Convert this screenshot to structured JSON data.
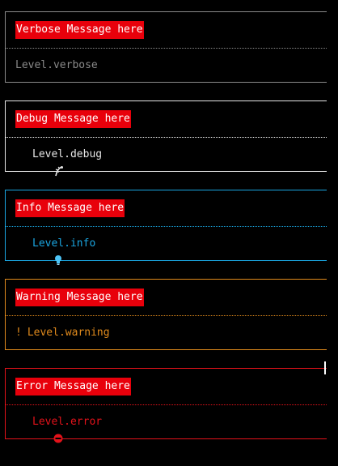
{
  "colors": {
    "verbose": "#8a8a8a",
    "debug": "#e6e6e6",
    "info": "#1aa5e0",
    "warning": "#e08a1c",
    "error": "#e3121a",
    "title_bg": "#e8000b"
  },
  "logs": [
    {
      "message": "Verbose Message here",
      "level": "Level.verbose",
      "icon": "none"
    },
    {
      "message": "Debug Message here",
      "level": "Level.debug",
      "icon": "bug-icon"
    },
    {
      "message": "Info Message here",
      "level": "Level.info",
      "icon": "lightbulb-icon"
    },
    {
      "message": "Warning Message here",
      "level": "Level.warning",
      "icon": "exclamation-icon",
      "icon_glyph": "!"
    },
    {
      "message": "Error Message here",
      "level": "Level.error",
      "icon": "no-entry-icon"
    }
  ]
}
